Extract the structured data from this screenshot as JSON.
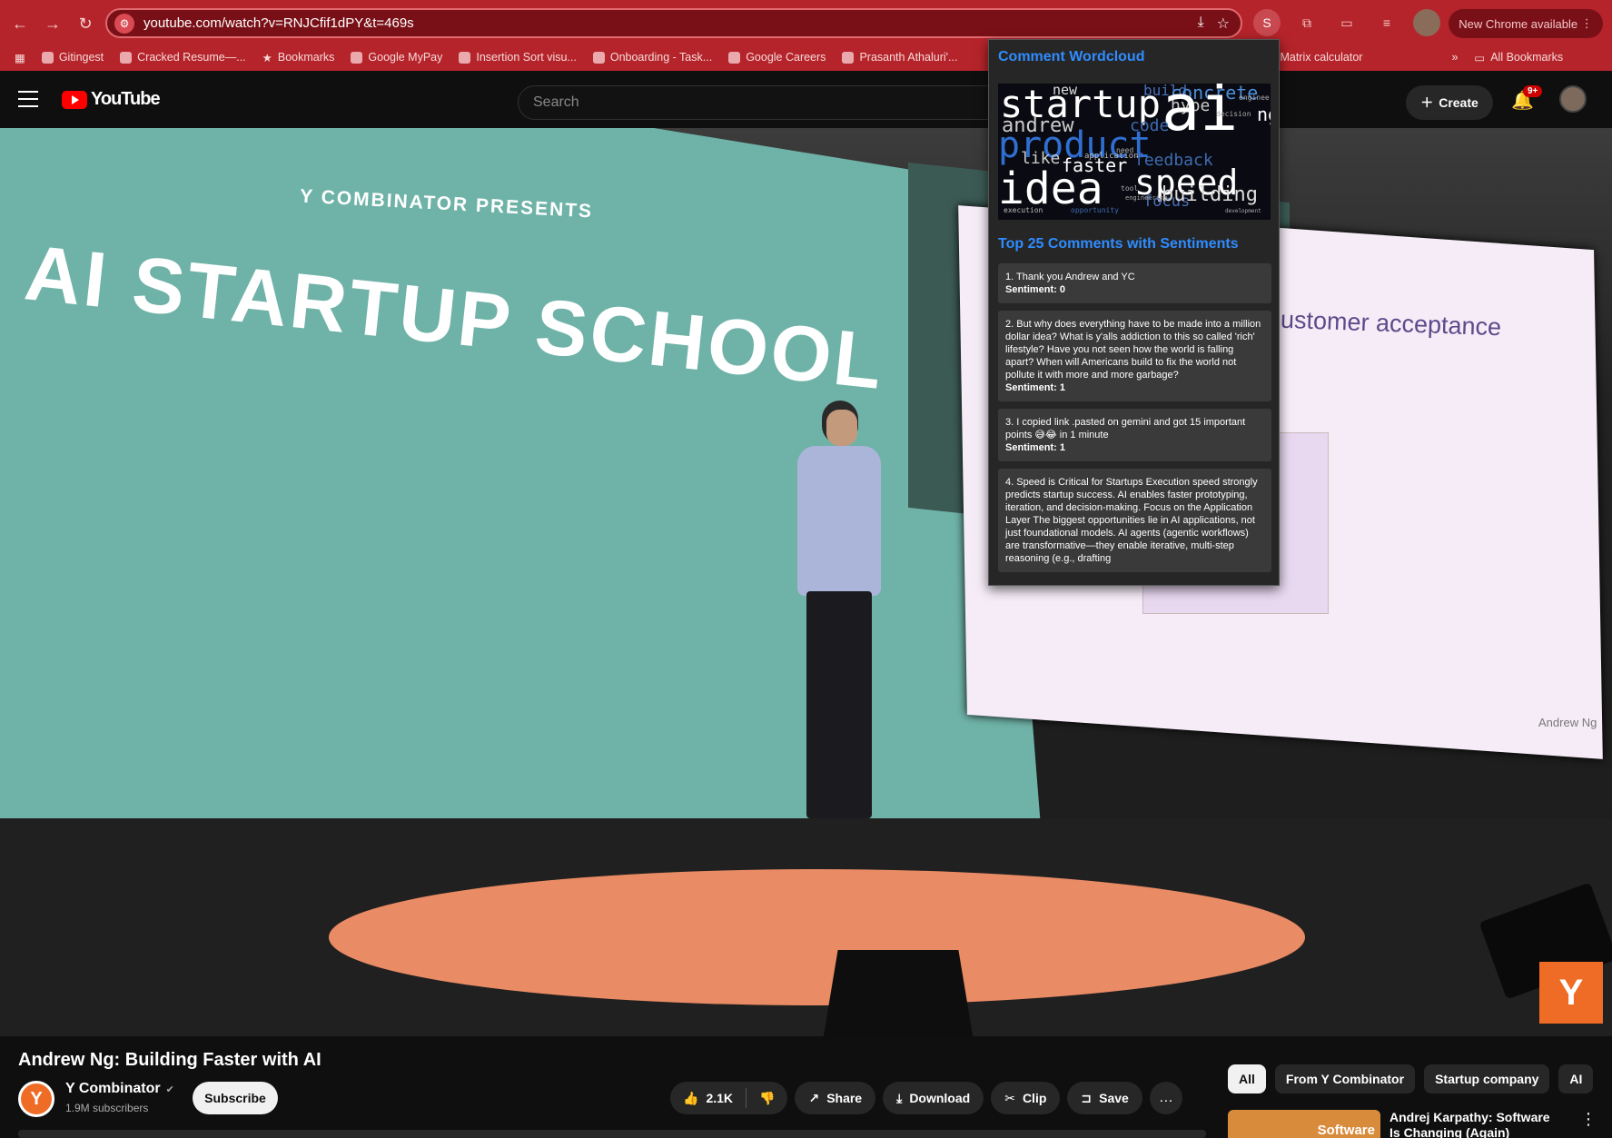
{
  "browser": {
    "url": "youtube.com/watch?v=RNJCfif1dPY&t=469s",
    "profile_initial": "S",
    "update_label": "New Chrome available",
    "bookmarks": [
      "Gitingest",
      "Cracked Resume—...",
      "Bookmarks",
      "Google MyPay",
      "Insertion Sort visu...",
      "Onboarding - Task...",
      "Google Careers",
      "Prasanth Athaluri'...",
      "Matrix calculator"
    ],
    "all_bookmarks": "All Bookmarks"
  },
  "youtube": {
    "logo": "YouTube",
    "search_placeholder": "Search",
    "create_label": "Create",
    "notif_count": "9+"
  },
  "video": {
    "presents": "Y COMBINATOR PRESENTS",
    "headline": "AI STARTUP SCHOOL",
    "slide_text": "ustomer acceptance",
    "slide_author": "Andrew Ng",
    "badge": "Y"
  },
  "meta": {
    "title": "Andrew Ng: Building Faster with AI",
    "channel": "Y Combinator",
    "channel_initial": "Y",
    "verified": "✔",
    "subscribers": "1.9M subscribers",
    "subscribe": "Subscribe",
    "likes": "2.1K",
    "share": "Share",
    "download": "Download",
    "clip": "Clip",
    "save": "Save",
    "more": "…"
  },
  "chips": [
    "All",
    "From Y Combinator",
    "Startup company",
    "AI"
  ],
  "recommendation": {
    "thumb_text": "Software",
    "title": "Andrej Karpathy: Software Is Changing (Again)"
  },
  "popup": {
    "wordcloud_title": "Comment Wordcloud",
    "words": [
      {
        "t": "new",
        "c": "#dddddd",
        "s": 15
      },
      {
        "t": "build",
        "c": "#4a6fb5",
        "s": 16
      },
      {
        "t": "concrete",
        "c": "#4a8fd9",
        "s": 20
      },
      {
        "t": "startup",
        "c": "#ffffff",
        "s": 42
      },
      {
        "t": "hype",
        "c": "#cccccc",
        "s": 18
      },
      {
        "t": "ai",
        "c": "#ffffff",
        "s": 70
      },
      {
        "t": "ng",
        "c": "#ffffff",
        "s": 20
      },
      {
        "t": "andrew",
        "c": "#cccccc",
        "s": 22
      },
      {
        "t": "code",
        "c": "#3e6cb0",
        "s": 18
      },
      {
        "t": "product",
        "c": "#2f6fd1",
        "s": 40
      },
      {
        "t": "like",
        "c": "#cccccc",
        "s": 18
      },
      {
        "t": "faster",
        "c": "#ffffff",
        "s": 20
      },
      {
        "t": "feedback",
        "c": "#3e6cb0",
        "s": 18
      },
      {
        "t": "idea",
        "c": "#ffffff",
        "s": 48
      },
      {
        "t": "speed",
        "c": "#ffffff",
        "s": 38
      },
      {
        "t": "focus",
        "c": "#4a6fb5",
        "s": 17
      },
      {
        "t": "building",
        "c": "#dddddd",
        "s": 22
      },
      {
        "t": "execution",
        "c": "#bbbbbb",
        "s": 8
      },
      {
        "t": "opportunity",
        "c": "#3e6cb0",
        "s": 8
      },
      {
        "t": "application",
        "c": "#bbbbbb",
        "s": 9
      },
      {
        "t": "decision",
        "c": "#aaaaaa",
        "s": 8
      },
      {
        "t": "engineer",
        "c": "#aaaaaa",
        "s": 8
      },
      {
        "t": "tool",
        "c": "#aaaaaa",
        "s": 8
      },
      {
        "t": "need",
        "c": "#aaaaaa",
        "s": 8
      },
      {
        "t": "engineering",
        "c": "#aaaaaa",
        "s": 7
      },
      {
        "t": "development",
        "c": "#aaaaaa",
        "s": 6
      }
    ],
    "comments_title": "Top 25 Comments with Sentiments",
    "comments": [
      {
        "text": "1. Thank you Andrew and YC",
        "sentiment": "Sentiment: 0"
      },
      {
        "text": "2. But why does everything have to be made into a million dollar idea? What is y'alls addiction to this so called 'rich' lifestyle? Have you not seen how the world is falling apart? When will Americans build to fix the world not pollute it with more and more garbage?",
        "sentiment": "Sentiment: 1"
      },
      {
        "text": "3. I copied link .pasted on gemini and got 15 important points 😅😂 in 1 minute",
        "sentiment": "Sentiment: 1"
      },
      {
        "text": "4. Speed is Critical for Startups Execution speed strongly predicts startup success. AI enables faster prototyping, iteration, and decision-making. Focus on the Application Layer The biggest opportunities lie in AI applications, not just foundational models. AI agents (agentic workflows) are transformative—they enable iterative, multi-step reasoning (e.g., drafting",
        "sentiment": ""
      }
    ]
  }
}
